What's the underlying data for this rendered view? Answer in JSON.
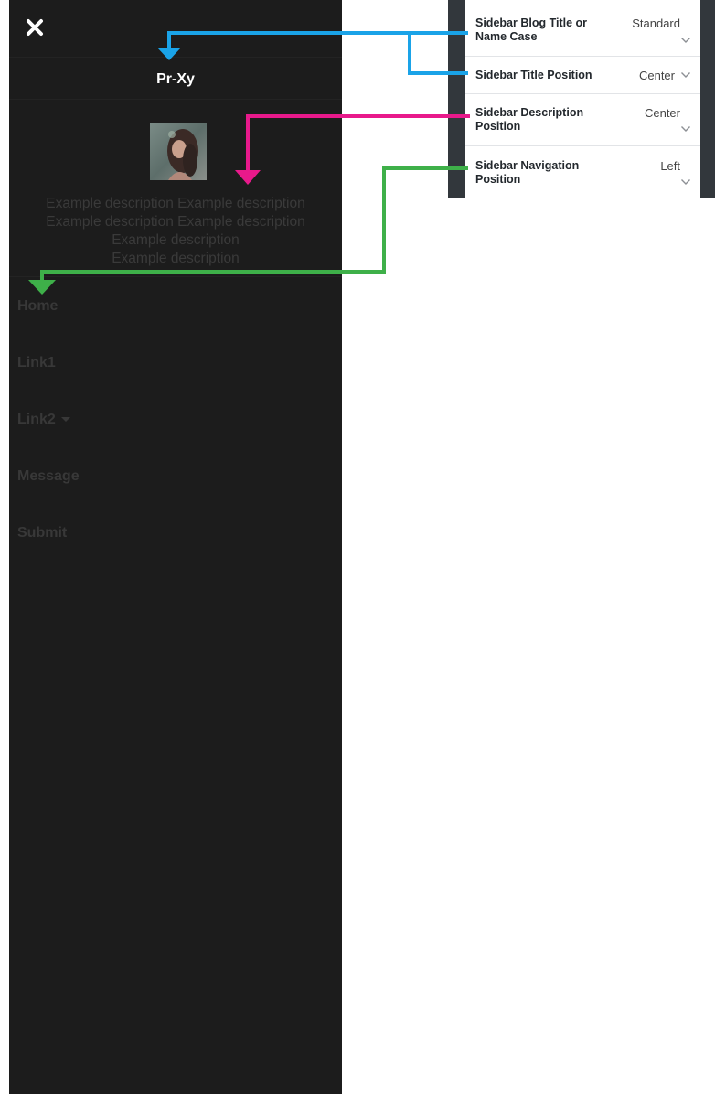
{
  "sidebar": {
    "title": "Pr-Xy",
    "description_lines": [
      "Example description Example description",
      "Example description Example description",
      "Example description",
      "Example description"
    ],
    "nav": [
      {
        "label": "Home"
      },
      {
        "label": "Link1"
      },
      {
        "label": "Link2",
        "has_dropdown": true
      },
      {
        "label": "Message"
      },
      {
        "label": "Submit"
      }
    ]
  },
  "settings": [
    {
      "label": "Sidebar Blog Title or Name Case",
      "value": "Standard"
    },
    {
      "label": "Sidebar Title Position",
      "value": "Center"
    },
    {
      "label": "Sidebar Description Position",
      "value": "Center"
    },
    {
      "label": "Sidebar Navigation Position",
      "value": "Left"
    }
  ],
  "colors": {
    "sidebar_bg": "#1c1c1c",
    "title_arrow": "#1aa3e8",
    "description_arrow": "#e8198b",
    "navigation_arrow": "#3eb049",
    "panel_frame": "#32373c"
  },
  "icons": {
    "close": "close-icon",
    "chevron": "chevron-down-icon",
    "caret": "caret-down-icon"
  }
}
